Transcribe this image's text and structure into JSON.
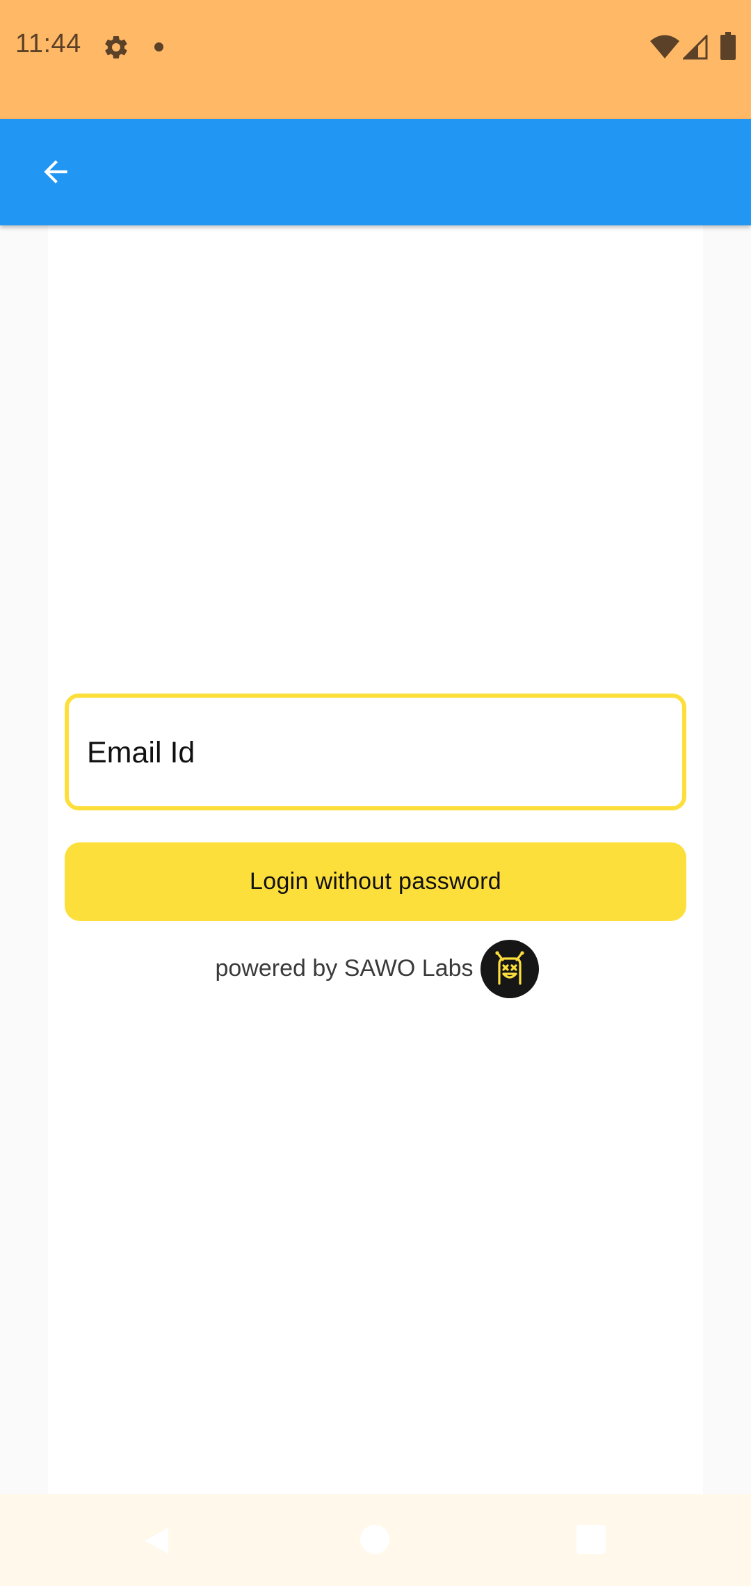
{
  "status_bar": {
    "time": "11:44",
    "background_color": "#ffb866",
    "icons": [
      "gear-icon",
      "notification-dot-icon",
      "wifi-icon",
      "cell-signal-icon",
      "battery-icon"
    ]
  },
  "app_bar": {
    "background_color": "#2196f3",
    "back_icon": "arrow-left-icon"
  },
  "login_form": {
    "email_placeholder": "Email Id",
    "email_value": "",
    "login_button_label": "Login without password",
    "accent_color": "#fddf3c"
  },
  "footer": {
    "powered_by_text": "powered by SAWO Labs",
    "logo_icon": "sawo-labs-logo"
  },
  "nav_bar": {
    "buttons": [
      "nav-back-icon",
      "nav-home-icon",
      "nav-recents-icon"
    ]
  }
}
